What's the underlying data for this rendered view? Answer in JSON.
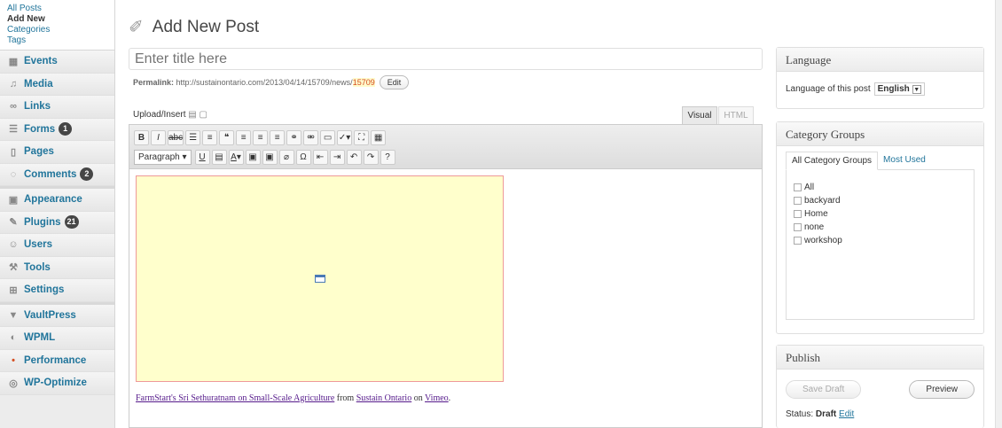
{
  "sidebar": {
    "submenu": [
      "All Posts",
      "Add New",
      "Categories",
      "Tags"
    ],
    "submenu_current": "Add New",
    "items": [
      {
        "label": "Events",
        "icon": "calendar-icon",
        "badge": null
      },
      {
        "label": "Media",
        "icon": "media-icon",
        "badge": null
      },
      {
        "label": "Links",
        "icon": "link-icon",
        "badge": null
      },
      {
        "label": "Forms",
        "icon": "forms-icon",
        "badge": "1"
      },
      {
        "label": "Pages",
        "icon": "pages-icon",
        "badge": null
      },
      {
        "label": "Comments",
        "icon": "comments-icon",
        "badge": "2"
      },
      {
        "label": "Appearance",
        "icon": "appearance-icon",
        "badge": null
      },
      {
        "label": "Plugins",
        "icon": "plugins-icon",
        "badge": "21"
      },
      {
        "label": "Users",
        "icon": "users-icon",
        "badge": null
      },
      {
        "label": "Tools",
        "icon": "tools-icon",
        "badge": null
      },
      {
        "label": "Settings",
        "icon": "settings-icon",
        "badge": null
      },
      {
        "label": "VaultPress",
        "icon": "vaultpress-icon",
        "badge": null
      },
      {
        "label": "WPML",
        "icon": "wpml-icon",
        "badge": null
      },
      {
        "label": "Performance",
        "icon": "performance-icon",
        "badge": null
      },
      {
        "label": "WP-Optimize",
        "icon": "optimize-icon",
        "badge": null
      }
    ]
  },
  "header": {
    "title": "Add New Post"
  },
  "post": {
    "title_placeholder": "Enter title here",
    "permalink_label": "Permalink:",
    "permalink_url": "http://sustainontario.com/2013/04/14/15709/news/",
    "permalink_slug": "15709",
    "edit_label": "Edit"
  },
  "editor": {
    "upload_label": "Upload/Insert",
    "tab_visual": "Visual",
    "tab_html": "HTML",
    "format_select": "Paragraph",
    "caption": {
      "link1": "FarmStart's Sri Sethuratnam on Small-Scale Agriculture",
      "from": " from ",
      "link2": "Sustain Ontario",
      "on": " on ",
      "link3": "Vimeo",
      "end": "."
    }
  },
  "language_box": {
    "title": "Language",
    "label": "Language of this post",
    "value": "English"
  },
  "category_box": {
    "title": "Category Groups",
    "tab_all": "All Category Groups",
    "tab_most": "Most Used",
    "items": [
      "All",
      "backyard",
      "Home",
      "none",
      "workshop"
    ]
  },
  "publish_box": {
    "title": "Publish",
    "save_draft": "Save Draft",
    "preview": "Preview",
    "status_label": "Status:",
    "status_value": "Draft",
    "status_edit": "Edit"
  },
  "colors": {
    "link": "#21759b",
    "embed_bg": "#ffffcc",
    "slug_highlight": "#fffbcc"
  }
}
